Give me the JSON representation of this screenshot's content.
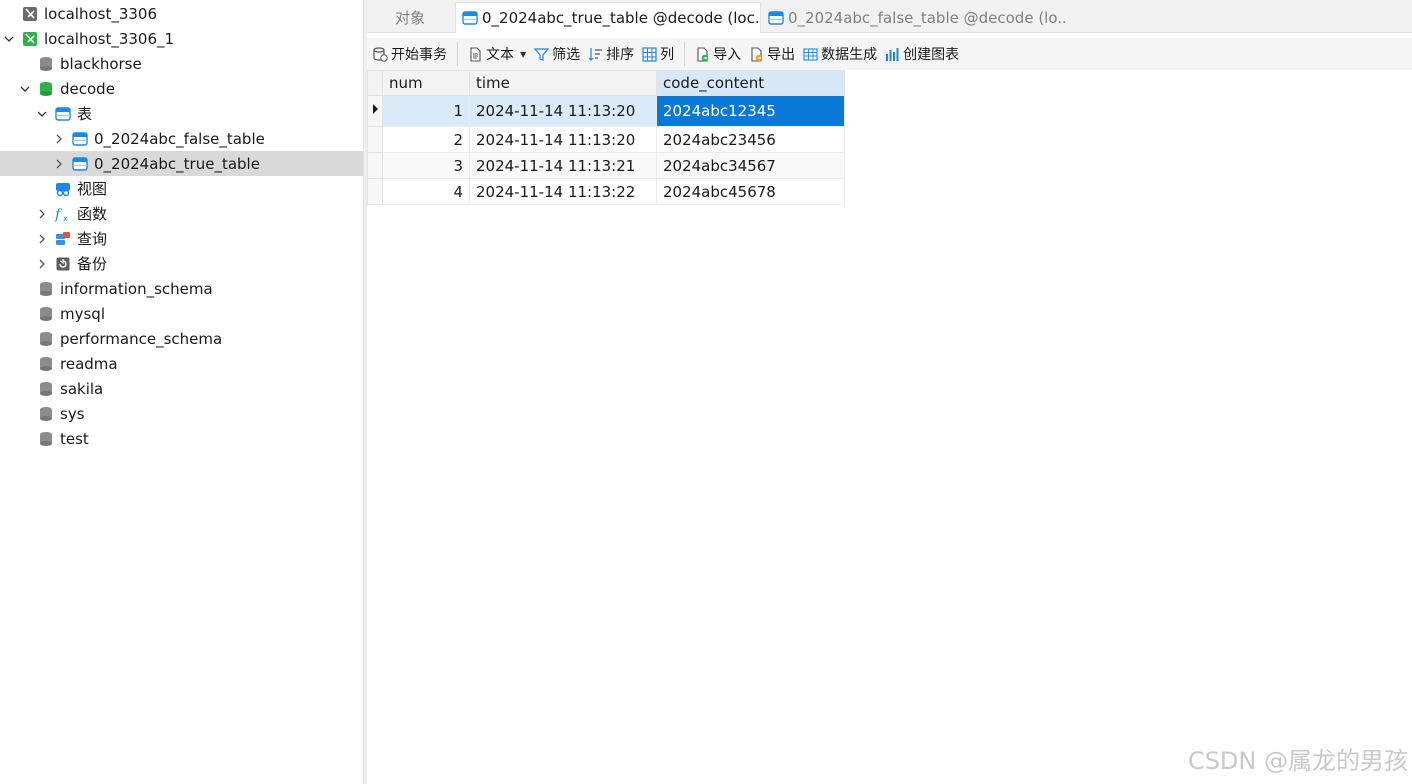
{
  "sidebar": {
    "items": [
      {
        "label": "localhost_3306"
      },
      {
        "label": "localhost_3306_1"
      },
      {
        "label": "blackhorse"
      },
      {
        "label": "decode"
      },
      {
        "label": "表"
      },
      {
        "label": "0_2024abc_false_table"
      },
      {
        "label": "0_2024abc_true_table"
      },
      {
        "label": "视图"
      },
      {
        "label": "函数"
      },
      {
        "label": "查询"
      },
      {
        "label": "备份"
      },
      {
        "label": "information_schema"
      },
      {
        "label": "mysql"
      },
      {
        "label": "performance_schema"
      },
      {
        "label": "readma"
      },
      {
        "label": "sakila"
      },
      {
        "label": "sys"
      },
      {
        "label": "test"
      }
    ]
  },
  "tabs": [
    {
      "label": "对象"
    },
    {
      "label": "0_2024abc_true_table @decode (loc..."
    },
    {
      "label": "0_2024abc_false_table @decode (lo..."
    }
  ],
  "toolbar": {
    "begin_transaction": "开始事务",
    "text": "文本",
    "filter": "筛选",
    "sort": "排序",
    "columns": "列",
    "import": "导入",
    "export": "导出",
    "data_generation": "数据生成",
    "create_chart": "创建图表"
  },
  "grid": {
    "columns": [
      "num",
      "time",
      "code_content"
    ],
    "rows": [
      [
        "1",
        "2024-11-14 11:13:20",
        "2024abc12345"
      ],
      [
        "2",
        "2024-11-14 11:13:20",
        "2024abc23456"
      ],
      [
        "3",
        "2024-11-14 11:13:21",
        "2024abc34567"
      ],
      [
        "4",
        "2024-11-14 11:13:22",
        "2024abc45678"
      ]
    ]
  },
  "watermark": "CSDN @属龙的男孩",
  "colors": {
    "selection": "#0a78d7",
    "current_row": "#d9ebfa",
    "db_active": "#2bb24c",
    "table_icon": "#1e88e5"
  }
}
